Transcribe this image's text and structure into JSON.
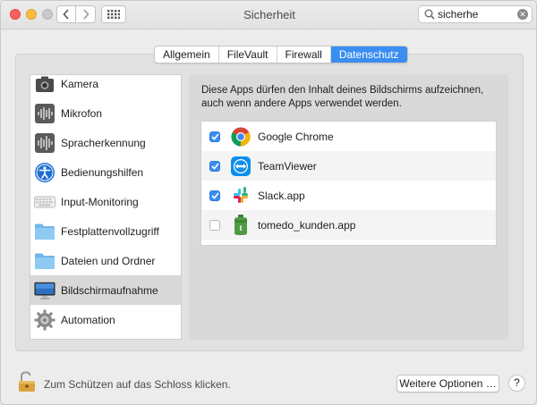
{
  "window": {
    "title": "Sicherheit",
    "colors": {
      "accent": "#3a8df1",
      "close": "#fc605c",
      "minimize": "#fdbc40"
    }
  },
  "toolbar": {
    "search_value": "sicherhe"
  },
  "tabs": [
    {
      "label": "Allgemein",
      "active": false
    },
    {
      "label": "FileVault",
      "active": false
    },
    {
      "label": "Firewall",
      "active": false
    },
    {
      "label": "Datenschutz",
      "active": true
    }
  ],
  "sidebar": {
    "items": [
      {
        "label": "Kamera",
        "icon": "camera-icon",
        "selected": false
      },
      {
        "label": "Mikrofon",
        "icon": "microphone-icon",
        "selected": false
      },
      {
        "label": "Spracherkennung",
        "icon": "speech-recognition-icon",
        "selected": false
      },
      {
        "label": "Bedienungshilfen",
        "icon": "accessibility-icon",
        "selected": false
      },
      {
        "label": "Input-Monitoring",
        "icon": "keyboard-icon",
        "selected": false
      },
      {
        "label": "Festplattenvollzugriff",
        "icon": "folder-icon",
        "selected": false
      },
      {
        "label": "Dateien und Ordner",
        "icon": "folder-icon",
        "selected": false
      },
      {
        "label": "Bildschirmaufnahme",
        "icon": "display-icon",
        "selected": true
      },
      {
        "label": "Automation",
        "icon": "gear-icon",
        "selected": false
      }
    ]
  },
  "content": {
    "description": "Diese Apps dürfen den Inhalt deines Bildschirms aufzeichnen, auch wenn andere Apps verwendet werden.",
    "apps": [
      {
        "name": "Google Chrome",
        "checked": true,
        "icon": "chrome-icon"
      },
      {
        "name": "TeamViewer",
        "checked": true,
        "icon": "teamviewer-icon"
      },
      {
        "name": "Slack.app",
        "checked": true,
        "icon": "slack-icon"
      },
      {
        "name": "tomedo_kunden.app",
        "checked": false,
        "icon": "tomedo-icon"
      }
    ]
  },
  "footer": {
    "lock_text": "Zum Schützen auf das Schloss klicken.",
    "more_options_label": "Weitere Optionen …",
    "help_label": "?"
  }
}
